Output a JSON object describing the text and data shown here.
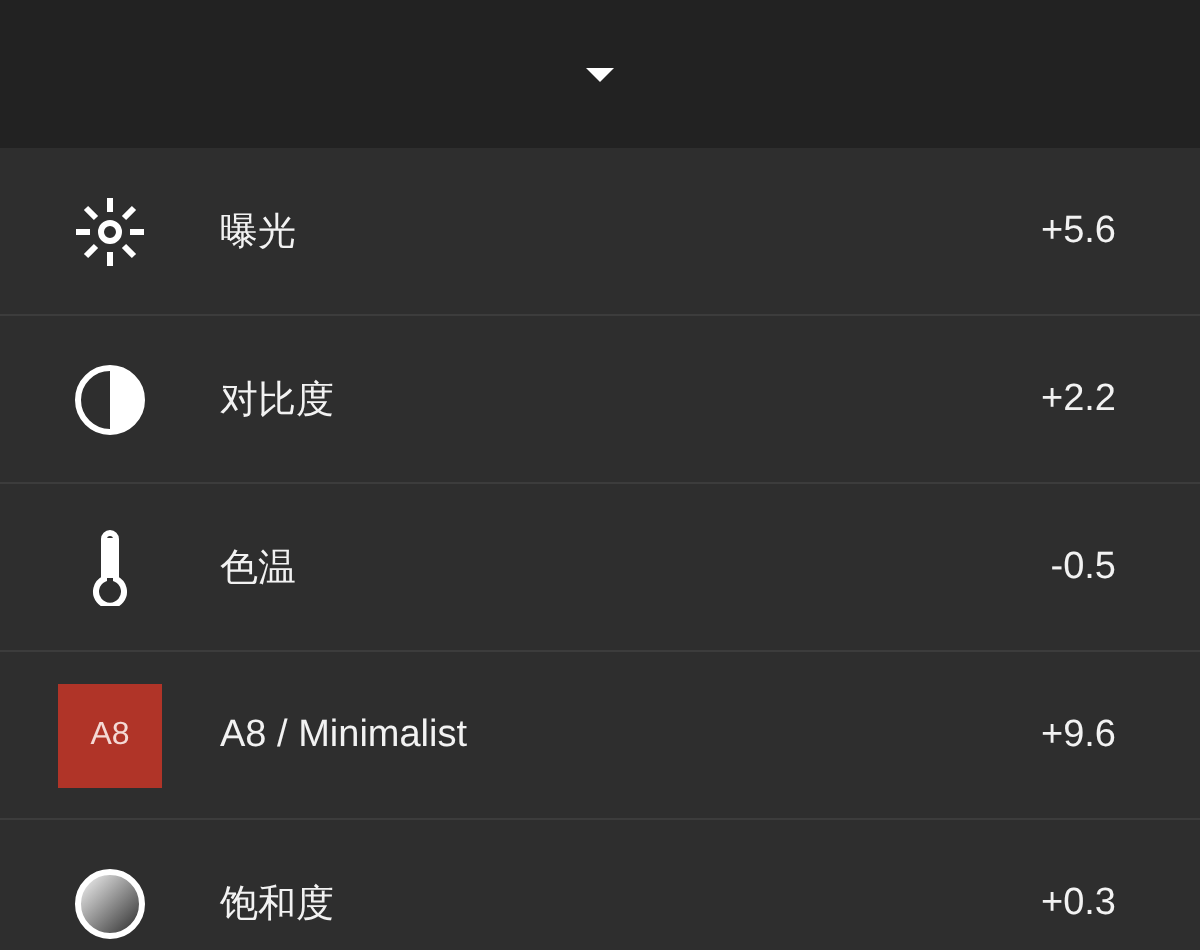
{
  "header": {
    "expanded": true
  },
  "adjustments": [
    {
      "kind": "exposure",
      "label": "曝光",
      "value": "+5.6"
    },
    {
      "kind": "contrast",
      "label": "对比度",
      "value": "+2.2"
    },
    {
      "kind": "temperature",
      "label": "色温",
      "value": "-0.5"
    },
    {
      "kind": "preset",
      "badge": "A8",
      "color": "#b03428",
      "label": "A8 / Minimalist",
      "value": "+9.6"
    },
    {
      "kind": "saturation",
      "label": "饱和度",
      "value": "+0.3"
    }
  ]
}
